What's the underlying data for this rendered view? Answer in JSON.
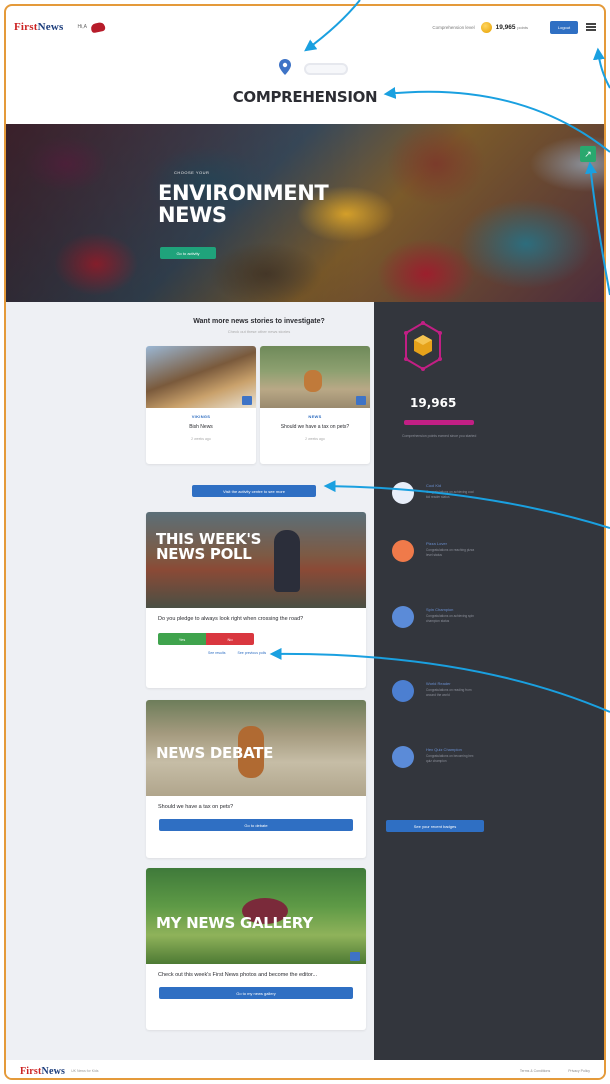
{
  "header": {
    "logo_first": "First",
    "logo_news": "News",
    "user_label": "Hi,A",
    "points_label": "Comprehension level",
    "points_value": "19,965",
    "points_unit": "points",
    "logout_label": "Logout"
  },
  "page_title": "COMPREHENSION",
  "hero": {
    "kicker": "CHOOSE YOUR",
    "title": "ENVIRONMENT NEWS",
    "button_label": "Go to activity"
  },
  "more_stories": {
    "title": "Want more news stories to investigate?",
    "subtitle": "Check out these other news stories",
    "cards": [
      {
        "kicker": "VIKINGS",
        "headline": "Bish News",
        "date": "2 weeks ago"
      },
      {
        "kicker": "NEWS",
        "headline": "Should we have a tax on pets?",
        "date": "2 weeks ago"
      }
    ],
    "check_button": "Visit the activity centre to see more"
  },
  "poll": {
    "image_title": "THIS WEEK'S NEWS POLL",
    "question": "Do you pledge to always look right when crossing the road?",
    "yes_label": "Yes",
    "no_label": "No",
    "link_results": "See results",
    "link_previous": "See previous polls"
  },
  "debate": {
    "image_title": "NEWS DEBATE",
    "question": "Should we have a tax on pets?",
    "button": "Go to debate"
  },
  "gallery": {
    "image_title": "MY NEWS GALLERY",
    "text": "Check out this week's First News photos and become the editor...",
    "button": "Go to my news gallery"
  },
  "sidebar": {
    "score": "19,965",
    "score_sub": "Comprehension points earned since you started",
    "badges": [
      {
        "name": "Cool Kid",
        "desc": "Congratulations on achieving cool kid reader status",
        "color": "#e8eef9"
      },
      {
        "name": "Pizza Lover",
        "desc": "Congratulations on reaching pizza level status",
        "color": "#f07a4a"
      },
      {
        "name": "Spin Champion",
        "desc": "Congratulations on achieving spin champion status",
        "color": "#5b8bd8"
      },
      {
        "name": "World Reader",
        "desc": "Congratulations on reading from around the world",
        "color": "#4c7fd1"
      },
      {
        "name": "Hex Quiz Champion",
        "desc": "Congratulations on becoming hex quiz champion",
        "color": "#5b8bd8"
      }
    ],
    "achievements_button": "See your recent badges"
  },
  "footer": {
    "tagline": "UK News for Kids",
    "links": [
      "Terms & Conditions",
      "Privacy Policy"
    ]
  },
  "colors": {
    "brand_blue": "#2f6fc3",
    "brand_red": "#c22222",
    "sidebar_bg": "#33363d",
    "score_bar": "#c21f84",
    "annotation": "#1aa0e0"
  }
}
